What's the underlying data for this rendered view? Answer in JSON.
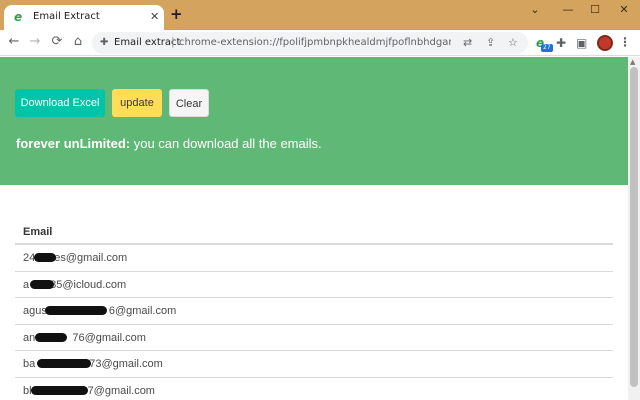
{
  "tab": {
    "favicon": "e",
    "title": "Email Extract",
    "close": "✕",
    "new_tab": "+"
  },
  "window_controls": {
    "dropdown": "⌄",
    "minimize": "—",
    "maximize": "☐",
    "close": "✕"
  },
  "toolbar": {
    "back": "←",
    "forward": "→",
    "reload": "⟳",
    "home": "⌂",
    "site_label": "Email extract",
    "separator": "|",
    "url": "chrome-extension://fpolifjpmbnpkhealdmjfpoflnbhdgan/app/email...",
    "ext_badge": "27"
  },
  "actions": {
    "download": "Download Excel",
    "update": "update",
    "clear": "Clear"
  },
  "promo": {
    "bold": "forever unLimited:",
    "text": " you can download all the emails."
  },
  "table": {
    "header": "Email",
    "rows": [
      {
        "prefix": "24",
        "suffix": "es@gmail.com"
      },
      {
        "prefix": "a",
        "suffix": "85@icloud.com"
      },
      {
        "prefix": "agus",
        "suffix": "6@gmail.com"
      },
      {
        "prefix": "and",
        "suffix": "76@gmail.com"
      },
      {
        "prefix": "ba",
        "suffix": "73@gmail.com"
      },
      {
        "prefix": "bl",
        "suffix": "7@gmail.com"
      }
    ]
  },
  "colors": {
    "tabstrip": "#d4a35d",
    "hero": "#60b877",
    "excel": "#00c4a7",
    "update": "#ffdd57"
  }
}
